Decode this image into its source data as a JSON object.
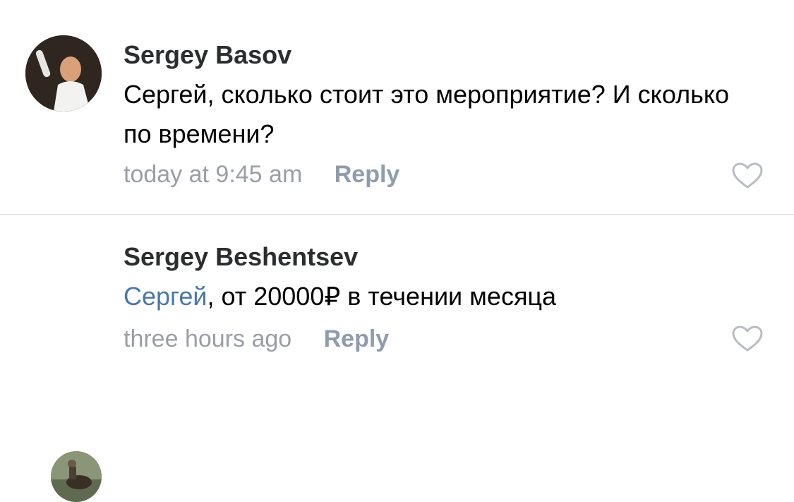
{
  "comments": [
    {
      "author": "Sergey Basov",
      "avatar_icon": "person-photo-avatar",
      "text": "Сергей, сколько стоит это мероприятие? И сколько по времени?",
      "time": "today at 9:45 am",
      "reply_label": "Reply",
      "like_icon": "heart-outline-icon"
    },
    {
      "author": "Sergey Beshentsev",
      "avatar_icon": "person-photo-avatar",
      "mention": "Сергей",
      "text": ", от 20000₽ в течении месяца",
      "time": "three hours ago",
      "reply_label": "Reply",
      "like_icon": "heart-outline-icon"
    }
  ],
  "colors": {
    "author": "#2c2d2e",
    "mention": "#4a76a8",
    "time": "#9a9ea5",
    "reply": "#8f9cae",
    "heart": "#b8bcc2",
    "divider": "#d9dadd"
  }
}
